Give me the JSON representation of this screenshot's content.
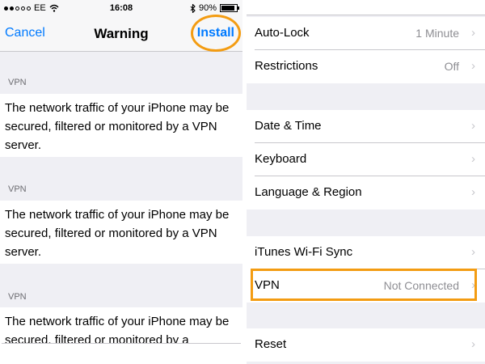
{
  "status_bar": {
    "carrier": "EE",
    "time": "16:08",
    "battery": "90%",
    "battery_level": 0.9
  },
  "nav": {
    "cancel": "Cancel",
    "title": "Warning",
    "install": "Install"
  },
  "warning_sections": [
    {
      "header": "VPN",
      "body": "The network traffic of your iPhone may be secured, filtered or monitored by a VPN server."
    },
    {
      "header": "VPN",
      "body": "The network traffic of your iPhone may be secured, filtered or monitored by a VPN server."
    },
    {
      "header": "VPN",
      "body": "The network traffic of your iPhone may be secured, filtered or monitored by a"
    }
  ],
  "settings": {
    "auto_lock": {
      "label": "Auto-Lock",
      "value": "1 Minute"
    },
    "restrictions": {
      "label": "Restrictions",
      "value": "Off"
    },
    "date_time": {
      "label": "Date & Time"
    },
    "keyboard": {
      "label": "Keyboard"
    },
    "language_region": {
      "label": "Language & Region"
    },
    "itunes_sync": {
      "label": "iTunes Wi-Fi Sync"
    },
    "vpn": {
      "label": "VPN",
      "value": "Not Connected"
    },
    "reset": {
      "label": "Reset"
    }
  },
  "icons": {
    "chevron": "chevron-right-icon",
    "wifi": "wifi-icon",
    "bluetooth": "bluetooth-icon",
    "battery": "battery-icon"
  },
  "colors": {
    "accent": "#007aff",
    "highlight": "#f39c12"
  }
}
